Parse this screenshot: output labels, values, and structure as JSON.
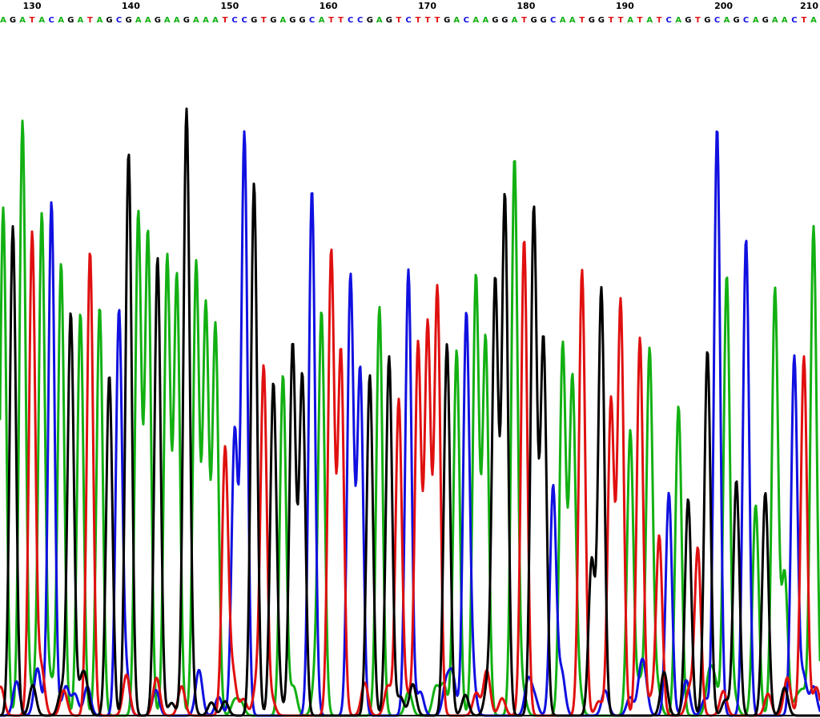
{
  "chart_data": {
    "type": "line",
    "title": "",
    "xlabel": "",
    "ylabel": "",
    "x_range": [
      127,
      210
    ],
    "grid": false,
    "legend": "none",
    "position_ticks": [
      "130",
      "140",
      "150",
      "160",
      "170",
      "180",
      "190",
      "200",
      "210"
    ],
    "sequence": "AGATACAGATAGCGAAGAAGAAATCCGTGAGGCATTCCGAGTCTTTGACAAGGATGGCAATGGTTATATCAGTGCAGCAGAACTA",
    "base_colors": {
      "A": "#12b012",
      "C": "#1010e0",
      "G": "#000000",
      "T": "#e01010"
    },
    "peak_heights": [
      82,
      79,
      96,
      78,
      81,
      83,
      73,
      65,
      65,
      75,
      66,
      55,
      65,
      91,
      81,
      78,
      74,
      74,
      71,
      97,
      73,
      66,
      63,
      43,
      46,
      94,
      86,
      56,
      53,
      55,
      60,
      55,
      85,
      64,
      75,
      59,
      71,
      56,
      55,
      66,
      58,
      51,
      72,
      60,
      63,
      69,
      60,
      59,
      64,
      71,
      61,
      70,
      84,
      90,
      77,
      82,
      61,
      37,
      60,
      54,
      72,
      25,
      69,
      51,
      67,
      46,
      61,
      59,
      29,
      36,
      50,
      35,
      27,
      59,
      95,
      71,
      38,
      77,
      34,
      36,
      69,
      23,
      58,
      58,
      79,
      68,
      31,
      59,
      75,
      72
    ]
  }
}
